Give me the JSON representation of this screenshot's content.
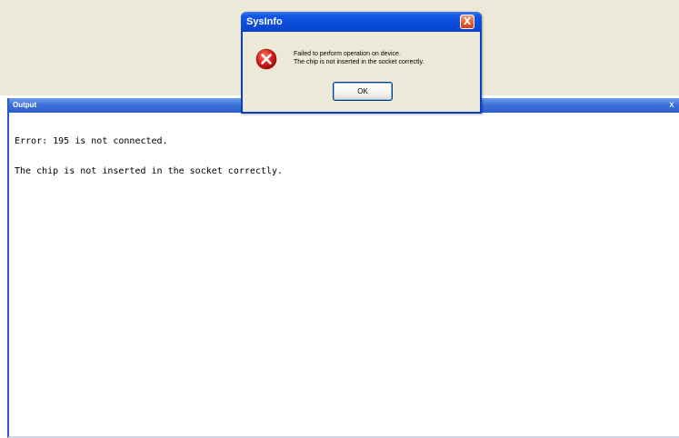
{
  "output": {
    "title": "Output",
    "close_glyph": "x",
    "lines": [
      "Error: 195 is not connected.",
      "The chip is not inserted in the socket correctly."
    ]
  },
  "dialog": {
    "title": "SysInfo",
    "close_glyph": "X",
    "icon": "error-icon",
    "message_lines": [
      "Failed to perform operation on device.",
      "The chip is not inserted in the socket correctly."
    ],
    "ok_label": "OK"
  },
  "colors": {
    "titlebar_blue": "#0a4bd8",
    "error_red": "#d8201a",
    "dialog_face": "#ece9d8"
  }
}
